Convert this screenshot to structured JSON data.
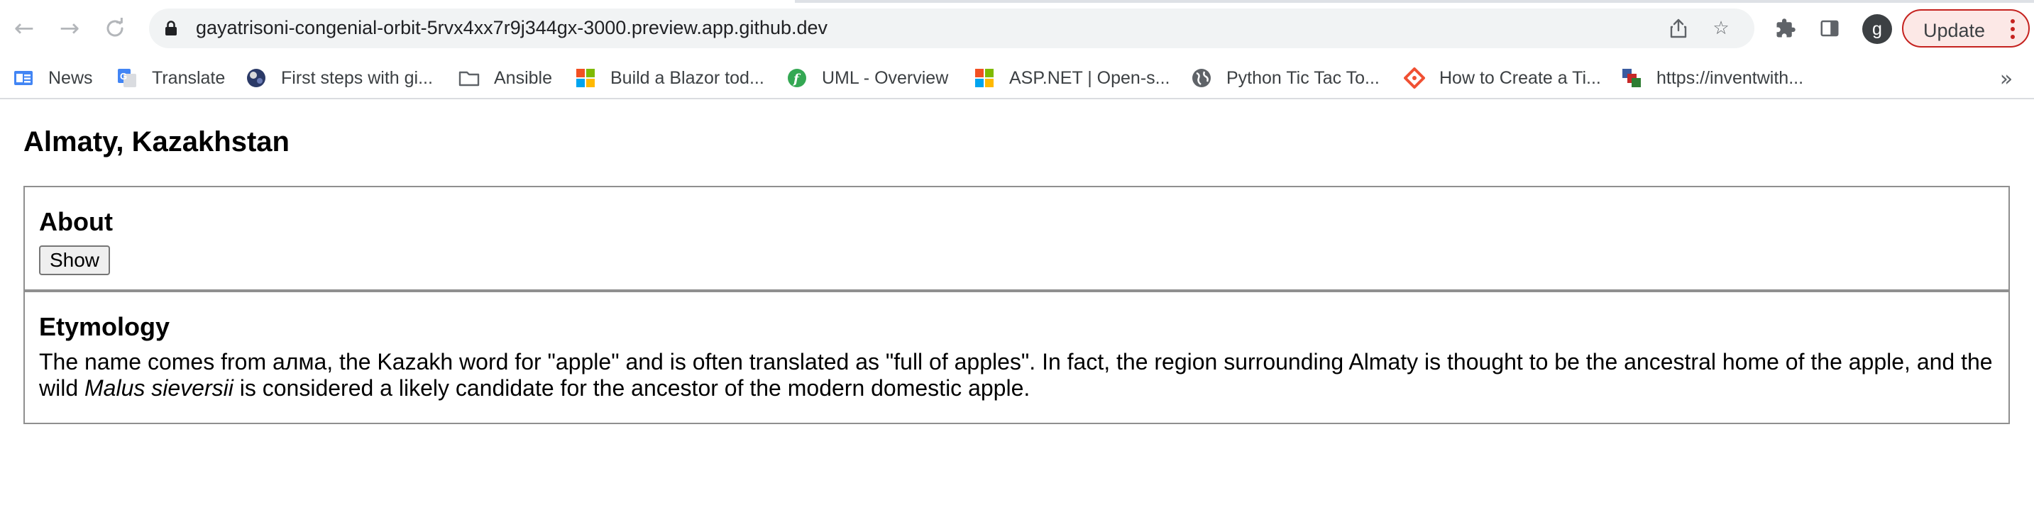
{
  "browser": {
    "url": "gayatrisoni-congenial-orbit-5rvx4xx7r9j344gx-3000.preview.app.github.dev",
    "profile_initial": "g",
    "update_label": "Update",
    "bookmarks": [
      {
        "label": "News",
        "icon": "google-news-icon"
      },
      {
        "label": "Translate",
        "icon": "google-translate-icon"
      },
      {
        "label": "First steps with gi...",
        "icon": "globe-photo-icon"
      },
      {
        "label": "Ansible",
        "icon": "folder-icon"
      },
      {
        "label": "Build a Blazor tod...",
        "icon": "microsoft-logo-icon"
      },
      {
        "label": "UML - Overview",
        "icon": "green-f-icon"
      },
      {
        "label": "ASP.NET | Open-s...",
        "icon": "microsoft-logo-icon"
      },
      {
        "label": "Python Tic Tac To...",
        "icon": "globe-icon"
      },
      {
        "label": "How to Create a Ti...",
        "icon": "git-diamond-icon"
      },
      {
        "label": "https://inventwith...",
        "icon": "multicolor-squares-icon"
      }
    ],
    "bookmarks_overflow": "»",
    "colors": {
      "toolbar_bg": "#ffffff",
      "omnibox_bg": "#f1f3f4",
      "update_border": "#c5221f",
      "update_bg": "#fce8e6"
    }
  },
  "page": {
    "title": "Almaty, Kazakhstan",
    "about": {
      "heading": "About",
      "button_label": "Show"
    },
    "etymology": {
      "heading": "Etymology",
      "text_part1": "The name comes from алма, the Kazakh word for \"apple\" and is often translated as \"full of apples\". In fact, the region surrounding Almaty is thought to be the ancestral home of the apple, and the wild ",
      "text_italic": "Malus sieversii",
      "text_part2": " is considered a likely candidate for the ancestor of the modern domestic apple."
    }
  }
}
